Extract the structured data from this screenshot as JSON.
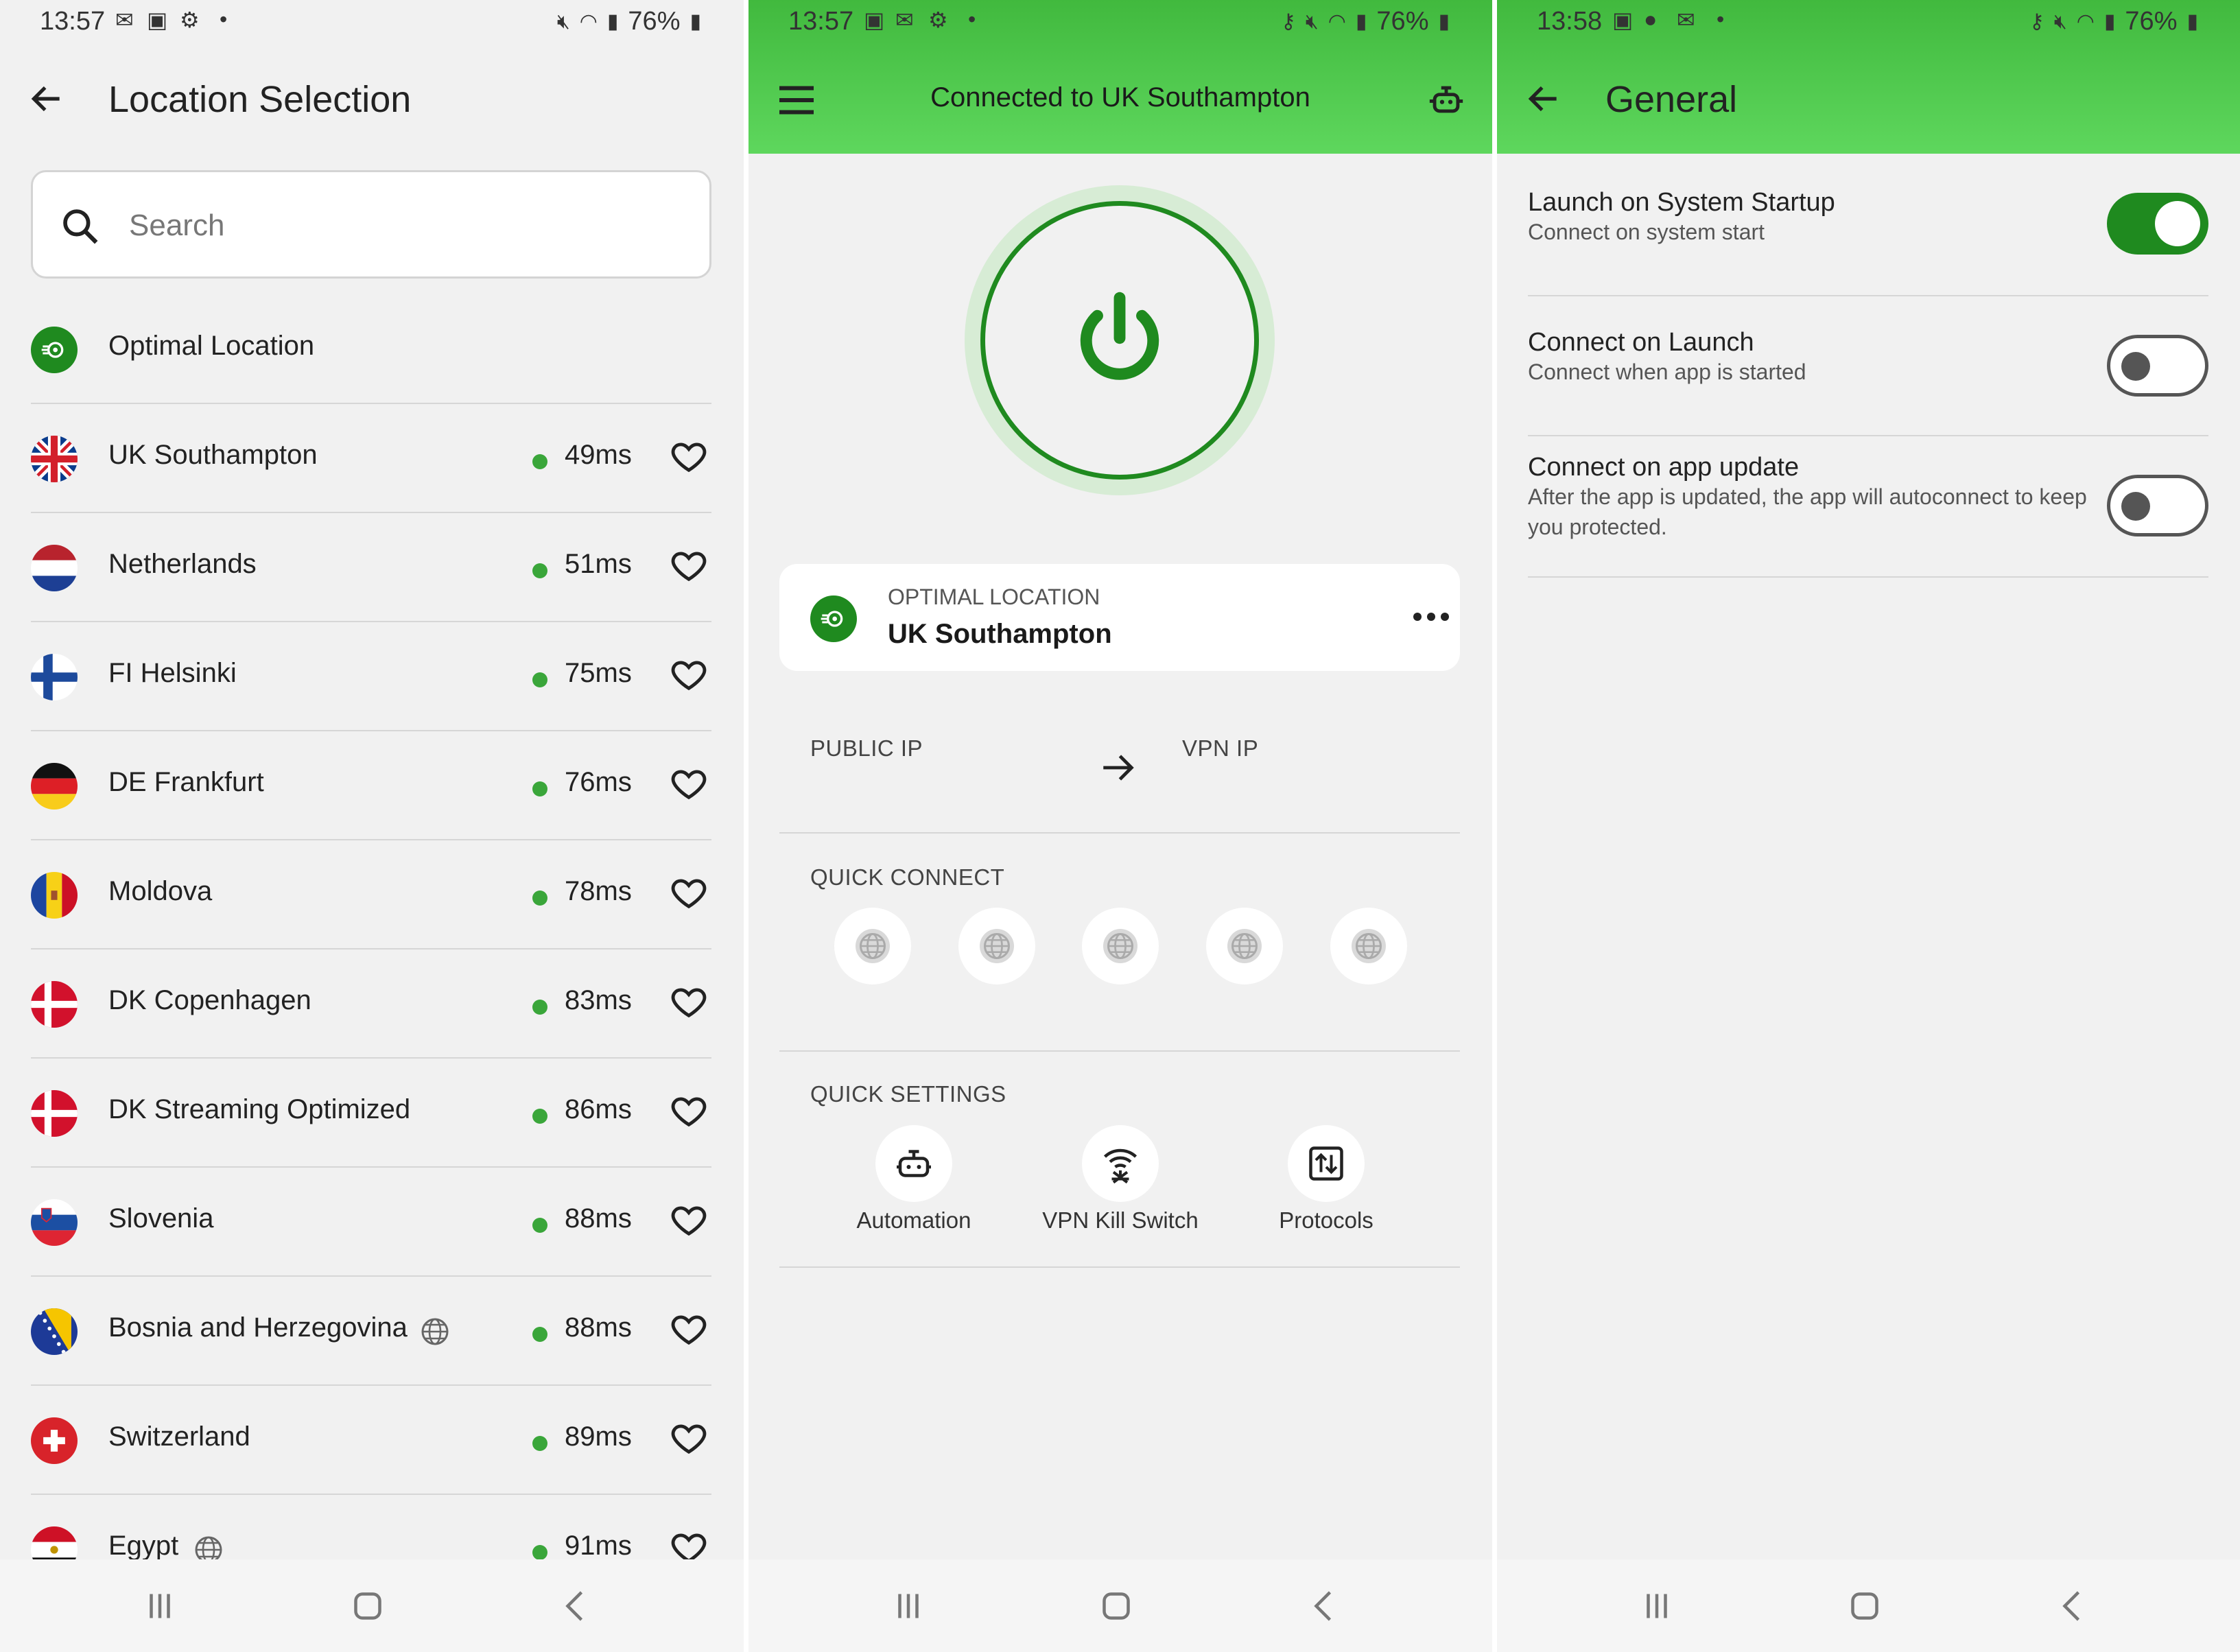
{
  "screen1": {
    "status": {
      "time": "13:57",
      "battery": "76%"
    },
    "title": "Location Selection",
    "search": {
      "placeholder": "Search"
    },
    "optimal": {
      "label": "Optimal Location"
    },
    "locations": [
      {
        "name": "UK Southampton",
        "ping": "49ms",
        "flag": "uk"
      },
      {
        "name": "Netherlands",
        "ping": "51ms",
        "flag": "nl"
      },
      {
        "name": "FI Helsinki",
        "ping": "75ms",
        "flag": "fi"
      },
      {
        "name": "DE Frankfurt",
        "ping": "76ms",
        "flag": "de"
      },
      {
        "name": "Moldova",
        "ping": "78ms",
        "flag": "md"
      },
      {
        "name": "DK Copenhagen",
        "ping": "83ms",
        "flag": "dk"
      },
      {
        "name": "DK Streaming Optimized",
        "ping": "86ms",
        "flag": "dk"
      },
      {
        "name": "Slovenia",
        "ping": "88ms",
        "flag": "si"
      },
      {
        "name": "Bosnia and Herzegovina",
        "ping": "88ms",
        "flag": "ba",
        "virtual": true
      },
      {
        "name": "Switzerland",
        "ping": "89ms",
        "flag": "ch"
      },
      {
        "name": "Egypt",
        "ping": "91ms",
        "flag": "eg",
        "virtual": true
      }
    ]
  },
  "screen2": {
    "status": {
      "time": "13:57",
      "battery": "76%"
    },
    "header_title": "Connected to UK Southampton",
    "location_card": {
      "label": "OPTIMAL LOCATION",
      "value": "UK Southampton"
    },
    "ip": {
      "public_label": "PUBLIC IP",
      "vpn_label": "VPN IP"
    },
    "quick_connect_label": "QUICK CONNECT",
    "quick_settings_label": "QUICK SETTINGS",
    "quick_settings": [
      {
        "label": "Automation"
      },
      {
        "label": "VPN Kill Switch"
      },
      {
        "label": "Protocols"
      }
    ]
  },
  "screen3": {
    "status": {
      "time": "13:58",
      "battery": "76%"
    },
    "title": "General",
    "settings": [
      {
        "title": "Launch on System Startup",
        "desc": "Connect on system start",
        "on": true
      },
      {
        "title": "Connect on Launch",
        "desc": "Connect when app is started",
        "on": false
      },
      {
        "title": "Connect on app update",
        "desc": "After the app is updated, the app will autoconnect to keep you protected.",
        "on": false
      }
    ]
  },
  "colors": {
    "brand_green": "#1f8a1f",
    "header_green": "#52cc50",
    "ping_dot": "#3aa63a"
  }
}
